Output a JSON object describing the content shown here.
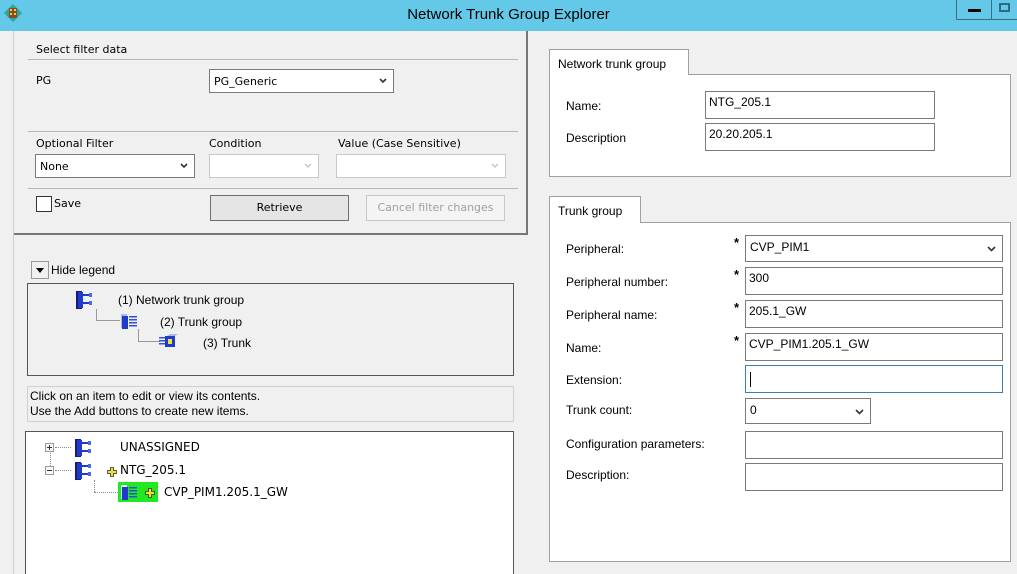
{
  "window": {
    "title": "Network Trunk Group Explorer",
    "controls": [
      "minimize",
      "maximize"
    ]
  },
  "filter": {
    "section_title": "Select filter data",
    "pg_label": "PG",
    "pg_value": "PG_Generic",
    "optional_filter_label": "Optional Filter",
    "optional_filter_value": "None",
    "condition_label": "Condition",
    "condition_value": "",
    "value_label": "Value (Case Sensitive)",
    "value_value": "",
    "save_label": "Save",
    "save_checked": false,
    "retrieve_label": "Retrieve",
    "cancel_label": "Cancel filter changes"
  },
  "legend": {
    "toggle_label": "Hide legend",
    "items": [
      {
        "label": "(1) Network trunk group",
        "icon": "network-trunk-group-icon"
      },
      {
        "label": "(2) Trunk group",
        "icon": "trunk-group-icon"
      },
      {
        "label": "(3) Trunk",
        "icon": "trunk-icon"
      }
    ]
  },
  "help": {
    "line1": "Click on an item to edit or view its contents.",
    "line2": "Use the Add buttons to create new items."
  },
  "tree": {
    "nodes": [
      {
        "label": "UNASSIGNED",
        "level": 0,
        "expanded": false,
        "modified": false
      },
      {
        "label": "NTG_205.1",
        "level": 0,
        "expanded": true,
        "modified": true
      },
      {
        "label": "CVP_PIM1.205.1_GW",
        "level": 1,
        "selected": true,
        "modified": true
      }
    ],
    "selected_color": "#22e822"
  },
  "ntg_form": {
    "tab_label": "Network trunk group",
    "name_label": "Name:",
    "name_value": "NTG_205.1",
    "description_label": "Description",
    "description_value": "20.20.205.1",
    "required_mark": "*"
  },
  "tg_form": {
    "tab_label": "Trunk group",
    "required_mark": "*",
    "peripheral_label": "Peripheral:",
    "peripheral_value": "CVP_PIM1",
    "peripheral_number_label": "Peripheral number:",
    "peripheral_number_value": "300",
    "peripheral_name_label": "Peripheral name:",
    "peripheral_name_value": "205.1_GW",
    "name_label": "Name:",
    "name_value": "CVP_PIM1.205.1_GW",
    "extension_label": "Extension:",
    "extension_value": "",
    "trunk_count_label": "Trunk count:",
    "trunk_count_value": "0",
    "config_params_label": "Configuration parameters:",
    "config_params_value": "",
    "description_label": "Description:",
    "description_value": ""
  }
}
